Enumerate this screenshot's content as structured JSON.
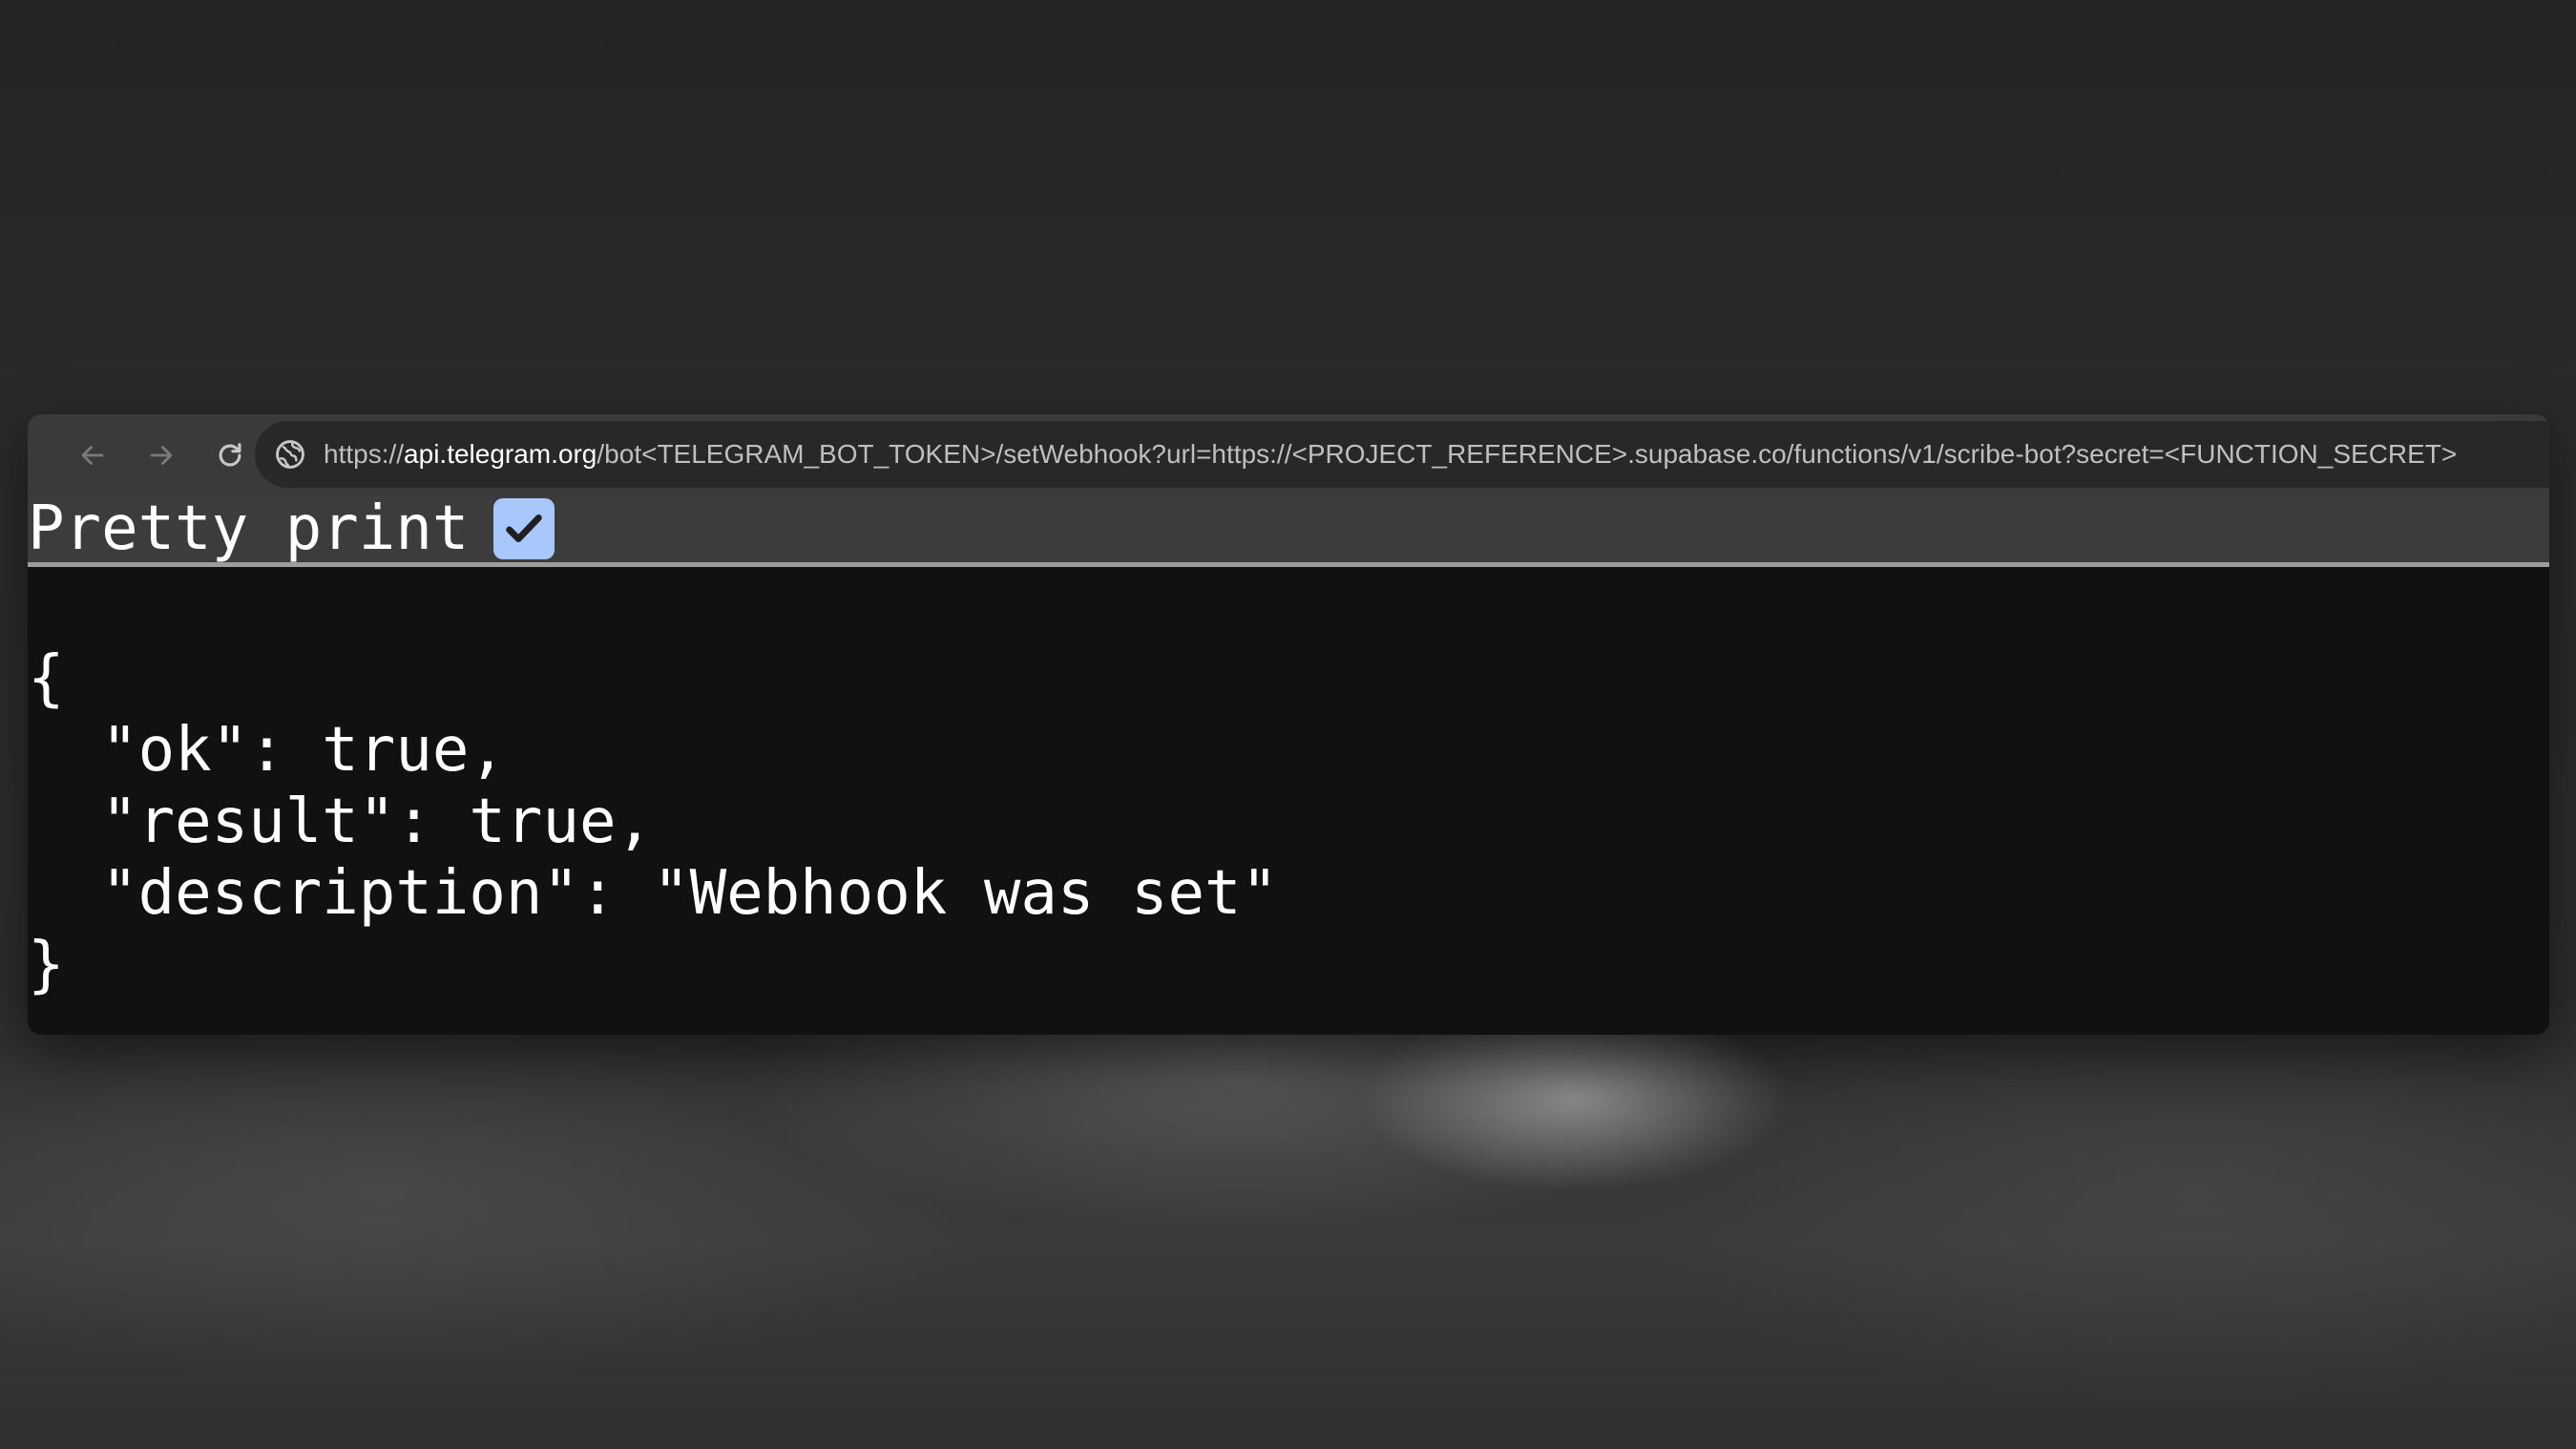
{
  "browser": {
    "url": {
      "scheme": "https://",
      "host": "api.telegram.org",
      "path": "/bot<TELEGRAM_BOT_TOKEN>/setWebhook?url=https://<PROJECT_REFERENCE>.supabase.co/functions/v1/scribe-bot?secret=<FUNCTION_SECRET>"
    },
    "nav_icons": [
      "back-arrow-icon",
      "forward-arrow-icon",
      "reload-icon",
      "site-info-icon"
    ]
  },
  "pretty_print": {
    "label": "Pretty print",
    "checked": true
  },
  "response": {
    "open_brace": "{",
    "close_brace": "}",
    "lines": [
      {
        "key": "\"ok\"",
        "sep": ": ",
        "value": "true",
        "trail": ","
      },
      {
        "key": "\"result\"",
        "sep": ": ",
        "value": "true",
        "trail": ","
      },
      {
        "key": "\"description\"",
        "sep": ": ",
        "value": "\"Webhook was set\"",
        "trail": ""
      }
    ]
  },
  "colors": {
    "toolbar_bg": "#3a3a3a",
    "omnibox_bg": "#282828",
    "content_bg": "#111111",
    "checkbox_accent": "#a8c7fa"
  }
}
